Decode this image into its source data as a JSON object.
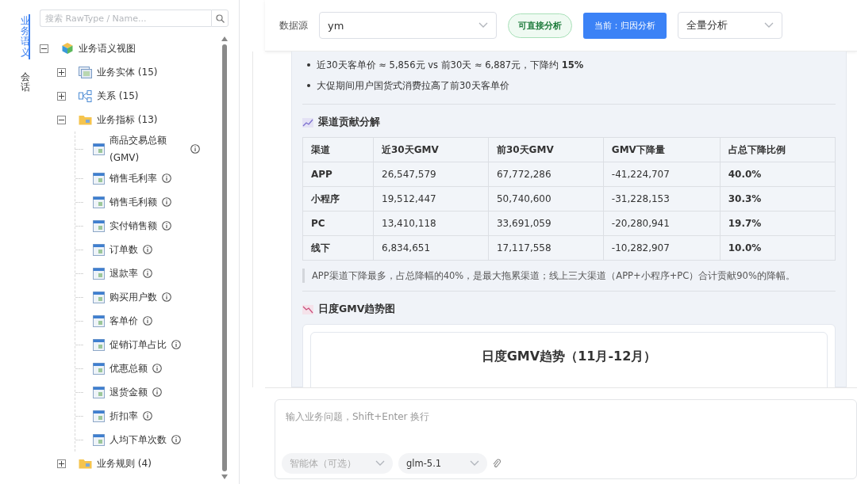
{
  "side_tabs": [
    {
      "label": "业务语义",
      "selected": true
    },
    {
      "label": "会话",
      "selected": false
    }
  ],
  "search": {
    "placeholder": "搜索 RawType / Name..."
  },
  "tree": {
    "label": "业务语义视图",
    "kind": "cube",
    "expanded": true,
    "children": [
      {
        "label": "业务实体 (15)",
        "kind": "entity",
        "expanded": false
      },
      {
        "label": "关系 (15)",
        "kind": "relation",
        "expanded": false
      },
      {
        "label": "业务指标 (13)",
        "kind": "folder",
        "expanded": true,
        "children": [
          {
            "label": "商品交易总额(GMV)",
            "kind": "metric"
          },
          {
            "label": "销售毛利率",
            "kind": "metric"
          },
          {
            "label": "销售毛利额",
            "kind": "metric"
          },
          {
            "label": "实付销售额",
            "kind": "metric"
          },
          {
            "label": "订单数",
            "kind": "metric"
          },
          {
            "label": "退款率",
            "kind": "metric"
          },
          {
            "label": "购买用户数",
            "kind": "metric"
          },
          {
            "label": "客单价",
            "kind": "metric"
          },
          {
            "label": "促销订单占比",
            "kind": "metric"
          },
          {
            "label": "优惠总额",
            "kind": "metric"
          },
          {
            "label": "退货金额",
            "kind": "metric"
          },
          {
            "label": "折扣率",
            "kind": "metric"
          },
          {
            "label": "人均下单次数",
            "kind": "metric"
          }
        ]
      },
      {
        "label": "业务规则 (4)",
        "kind": "folder",
        "expanded": false
      }
    ]
  },
  "toolbar": {
    "source_label": "数据源",
    "source_value": "ym",
    "status_badge": "可直接分析",
    "mode_button": "当前：归因分析",
    "scope_value": "全量分析"
  },
  "content": {
    "bullets": [
      "近30天客单价 ≈ 5,856元 vs 前30天 ≈ 6,887元，下降约 **15%**",
      "大促期间用户国货式消费拉高了前30天客单价"
    ],
    "section_1_title": "渠道贡献分解",
    "table": {
      "columns": [
        "渠道",
        "近30天GMV",
        "前30天GMV",
        "GMV下降量",
        "占总下降比例"
      ],
      "rows": [
        [
          "APP",
          "26,547,579",
          "67,772,286",
          "-41,224,707",
          "40.0%"
        ],
        [
          "小程序",
          "19,512,447",
          "50,740,600",
          "-31,228,153",
          "30.3%"
        ],
        [
          "PC",
          "13,410,118",
          "33,691,059",
          "-20,280,941",
          "19.7%"
        ],
        [
          "线下",
          "6,834,651",
          "17,117,558",
          "-10,282,907",
          "10.0%"
        ]
      ]
    },
    "note": "APP渠道下降最多，占总降幅的40%，是最大拖累渠道；线上三大渠道（APP+小程序+PC）合计贡献90%的降幅。",
    "section_2_title": "日度GMV趋势图",
    "chart_title": "日度GMV趋势（11月-12月）"
  },
  "composer": {
    "placeholder": "输入业务问题，Shift+Enter 换行",
    "agent_placeholder": "智能体（可选）",
    "model_value": "glm-5.1"
  }
}
